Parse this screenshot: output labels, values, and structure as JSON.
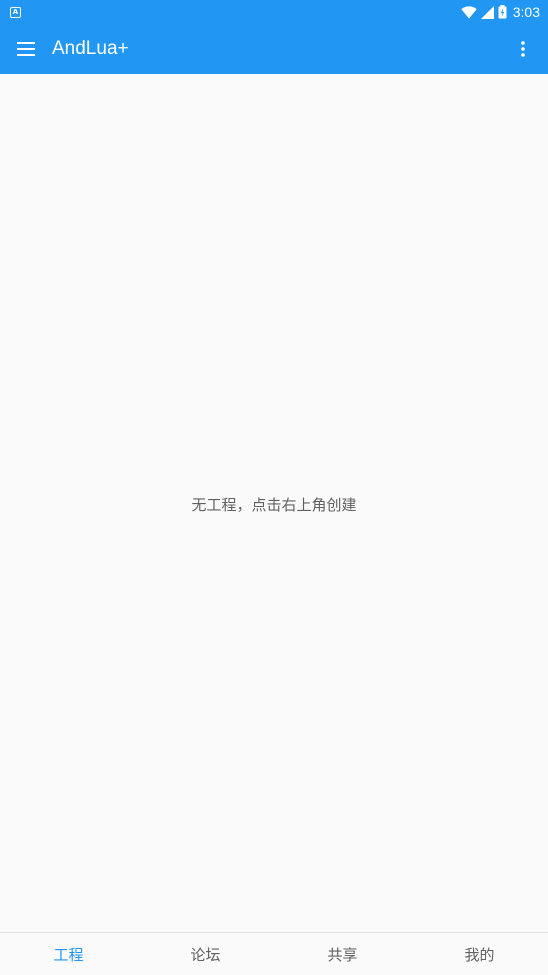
{
  "status_bar": {
    "notification_icon": "A",
    "time": "3:03"
  },
  "app_bar": {
    "title": "AndLua+"
  },
  "main": {
    "empty_message": "无工程，点击右上角创建"
  },
  "bottom_nav": {
    "items": [
      {
        "label": "工程",
        "active": true
      },
      {
        "label": "论坛",
        "active": false
      },
      {
        "label": "共享",
        "active": false
      },
      {
        "label": "我的",
        "active": false
      }
    ]
  },
  "colors": {
    "primary": "#2196f3",
    "background": "#fafafa",
    "text_secondary": "#616161"
  }
}
